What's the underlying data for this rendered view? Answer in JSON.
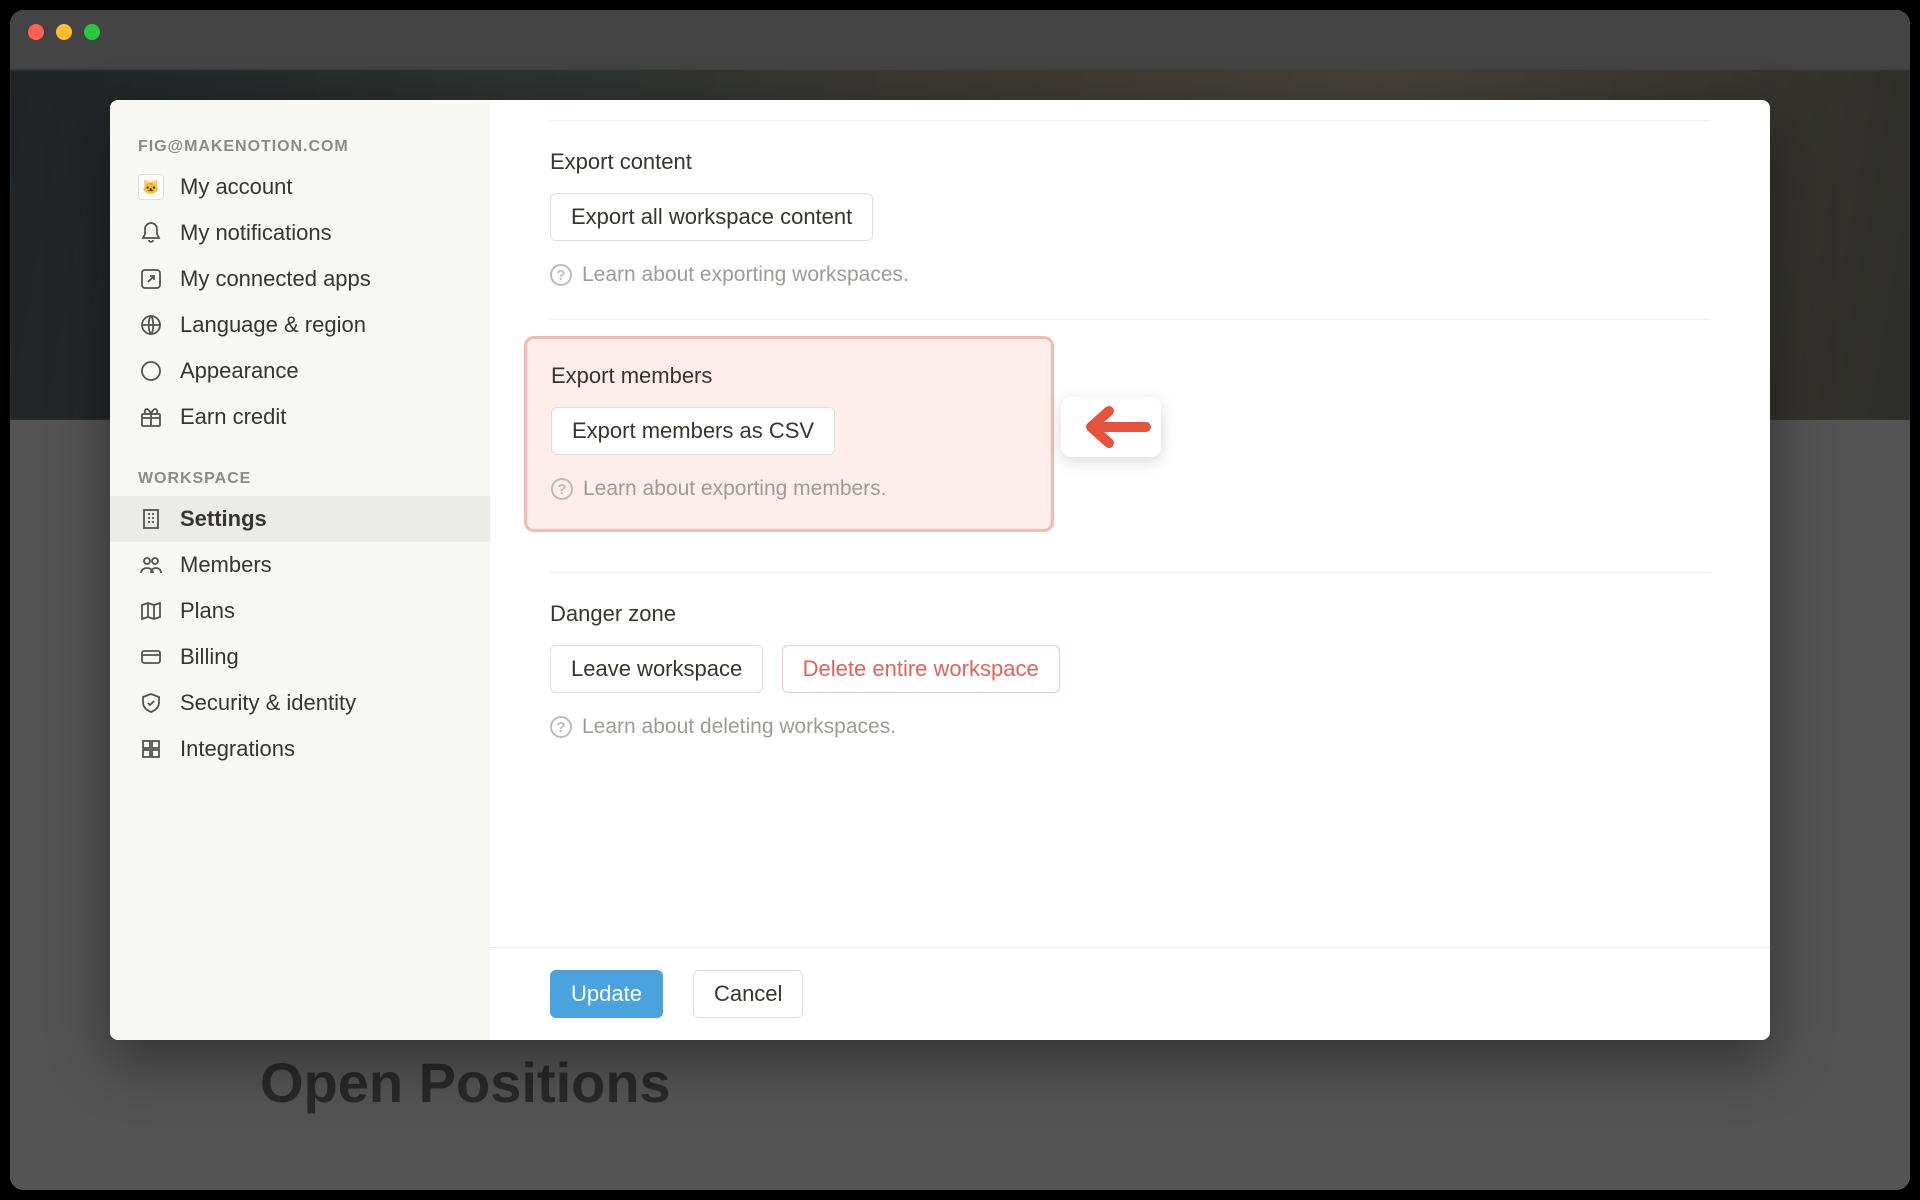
{
  "background": {
    "page_heading": "Open Positions"
  },
  "sidebar": {
    "account_header": "FIG@MAKENOTION.COM",
    "workspace_header": "WORKSPACE",
    "items": [
      {
        "label": "My account"
      },
      {
        "label": "My notifications"
      },
      {
        "label": "My connected apps"
      },
      {
        "label": "Language & region"
      },
      {
        "label": "Appearance"
      },
      {
        "label": "Earn credit"
      },
      {
        "label": "Settings"
      },
      {
        "label": "Members"
      },
      {
        "label": "Plans"
      },
      {
        "label": "Billing"
      },
      {
        "label": "Security & identity"
      },
      {
        "label": "Integrations"
      }
    ]
  },
  "settings": {
    "export_content": {
      "title": "Export content",
      "button": "Export all workspace content",
      "help": "Learn about exporting workspaces."
    },
    "export_members": {
      "title": "Export members",
      "button": "Export members as CSV",
      "help": "Learn about exporting members."
    },
    "danger_zone": {
      "title": "Danger zone",
      "leave_button": "Leave workspace",
      "delete_button": "Delete entire workspace",
      "help": "Learn about deleting workspaces."
    }
  },
  "footer": {
    "update": "Update",
    "cancel": "Cancel"
  },
  "help_glyph": "?"
}
